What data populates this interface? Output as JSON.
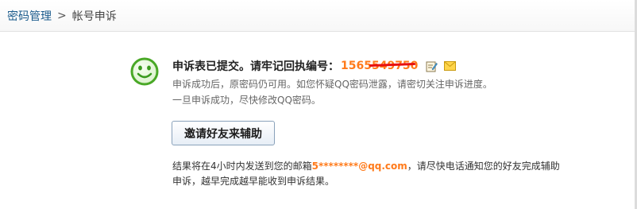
{
  "breadcrumb": {
    "parent": "密码管理",
    "separator": ">",
    "current": "帐号申诉"
  },
  "status": {
    "headline": "申诉表已提交。请牢记回执编号：",
    "receipt_number": "1565549750",
    "line1": "申诉成功后，原密码仍可用。如您怀疑QQ密码泄露，请密切关注申诉进度。",
    "line2": "一旦申诉成功，尽快修改QQ密码。"
  },
  "actions": {
    "invite_label": "邀请好友来辅助"
  },
  "result": {
    "prefix": "结果将在4小时内发送到您的邮箱",
    "email": "5********@qq.com",
    "suffix1": "，请尽快电话通知您的好友完成辅助",
    "suffix2": "申诉，越早完成越早能收到申诉结果。"
  },
  "icons": {
    "status": "smiley-face-icon",
    "edit": "edit-note-icon",
    "mail": "envelope-icon"
  },
  "colors": {
    "accent_orange": "#ff7a1a",
    "smiley_green": "#49a826",
    "link_blue": "#1b5b8c",
    "redaction_red": "#e81010"
  }
}
